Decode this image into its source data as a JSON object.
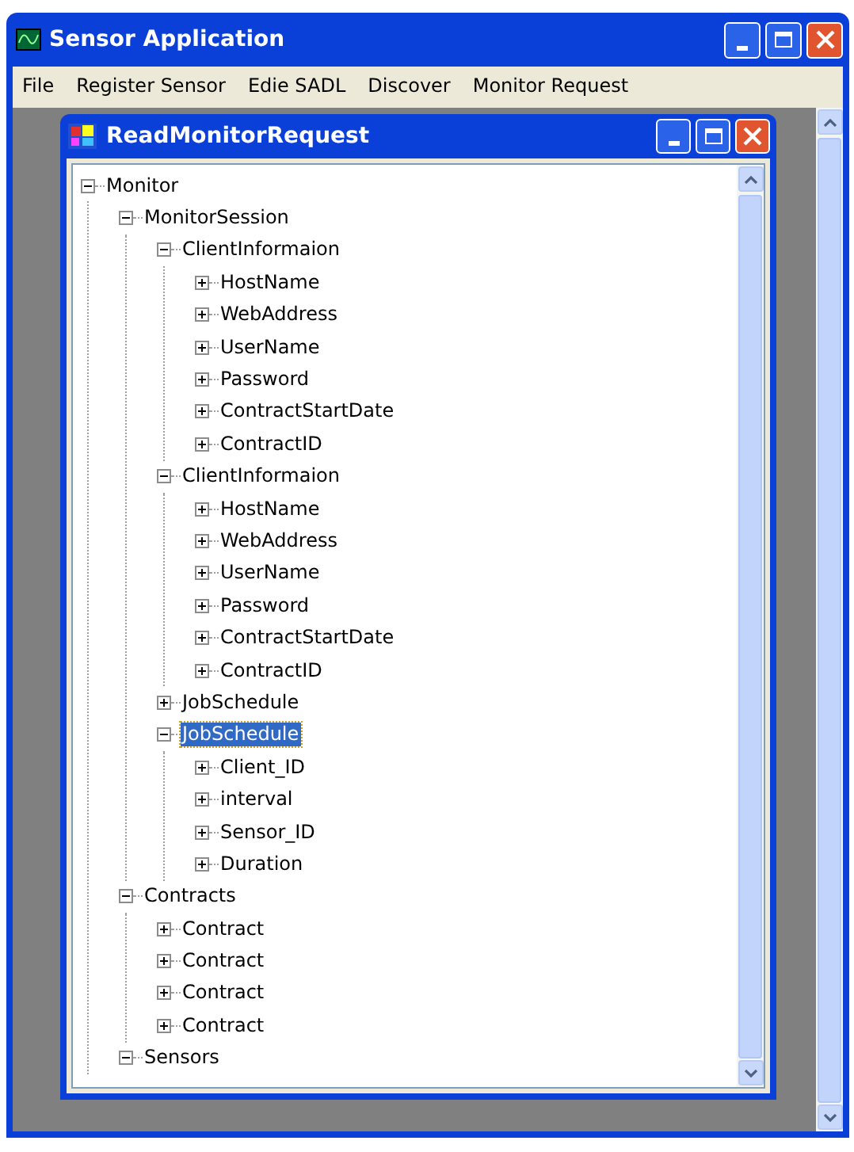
{
  "window": {
    "title": "Sensor Application"
  },
  "menu": [
    {
      "label": "File"
    },
    {
      "label": "Register Sensor"
    },
    {
      "label": "Edie SADL"
    },
    {
      "label": "Discover"
    },
    {
      "label": "Monitor Request"
    }
  ],
  "child_window": {
    "title": "ReadMonitorRequest"
  },
  "tree": [
    {
      "label": "Monitor",
      "expanded": true,
      "selected": false,
      "children": [
        {
          "label": "MonitorSession",
          "expanded": true,
          "selected": false,
          "children": [
            {
              "label": "ClientInformaion",
              "expanded": true,
              "selected": false,
              "children": [
                {
                  "label": "HostName",
                  "expanded": false,
                  "selected": false
                },
                {
                  "label": "WebAddress",
                  "expanded": false,
                  "selected": false
                },
                {
                  "label": "UserName",
                  "expanded": false,
                  "selected": false
                },
                {
                  "label": "Password",
                  "expanded": false,
                  "selected": false
                },
                {
                  "label": "ContractStartDate",
                  "expanded": false,
                  "selected": false
                },
                {
                  "label": "ContractID",
                  "expanded": false,
                  "selected": false
                }
              ]
            },
            {
              "label": "ClientInformaion",
              "expanded": true,
              "selected": false,
              "children": [
                {
                  "label": "HostName",
                  "expanded": false,
                  "selected": false
                },
                {
                  "label": "WebAddress",
                  "expanded": false,
                  "selected": false
                },
                {
                  "label": "UserName",
                  "expanded": false,
                  "selected": false
                },
                {
                  "label": "Password",
                  "expanded": false,
                  "selected": false
                },
                {
                  "label": "ContractStartDate",
                  "expanded": false,
                  "selected": false
                },
                {
                  "label": "ContractID",
                  "expanded": false,
                  "selected": false
                }
              ]
            },
            {
              "label": "JobSchedule",
              "expanded": false,
              "selected": false
            },
            {
              "label": "JobSchedule",
              "expanded": true,
              "selected": true,
              "children": [
                {
                  "label": "Client_ID",
                  "expanded": false,
                  "selected": false
                },
                {
                  "label": "interval",
                  "expanded": false,
                  "selected": false
                },
                {
                  "label": "Sensor_ID",
                  "expanded": false,
                  "selected": false
                },
                {
                  "label": "Duration",
                  "expanded": false,
                  "selected": false
                }
              ]
            }
          ]
        },
        {
          "label": "Contracts",
          "expanded": true,
          "selected": false,
          "children": [
            {
              "label": "Contract",
              "expanded": false,
              "selected": false
            },
            {
              "label": "Contract",
              "expanded": false,
              "selected": false
            },
            {
              "label": "Contract",
              "expanded": false,
              "selected": false
            },
            {
              "label": "Contract",
              "expanded": false,
              "selected": false
            }
          ]
        },
        {
          "label": "Sensors",
          "expanded": true,
          "selected": false
        }
      ]
    }
  ]
}
